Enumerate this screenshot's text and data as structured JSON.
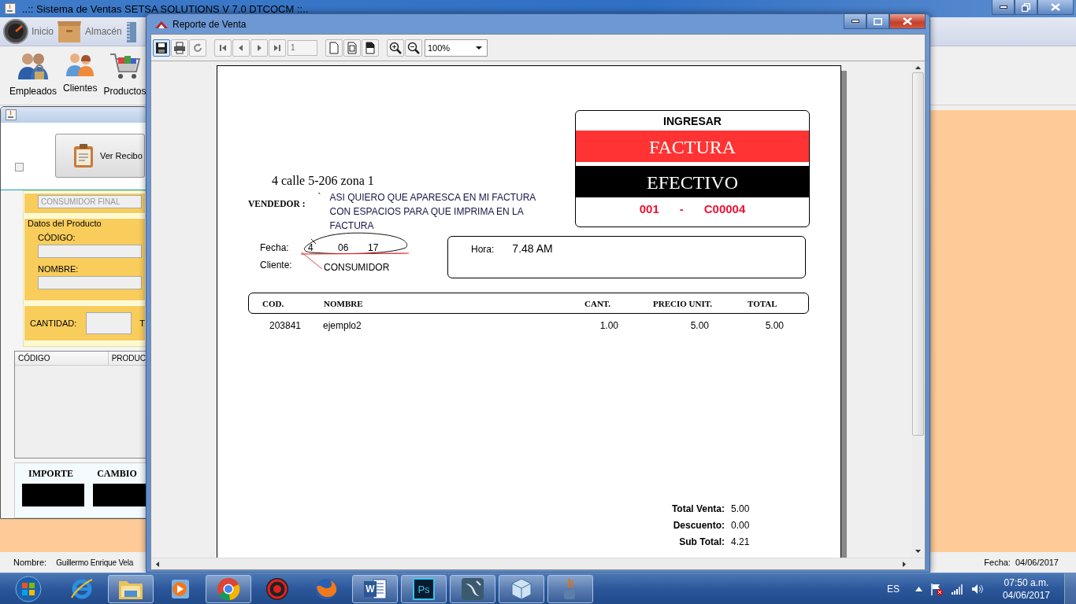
{
  "main_window": {
    "title": "..:: Sistema de Ventas SETSA SOLUTIONS V 7.0 DTCQCM ::..",
    "menu": [
      {
        "kind": "gauge",
        "label": "Inicio"
      },
      {
        "kind": "box",
        "label": "Almacén"
      },
      {
        "kind": "notebook"
      }
    ],
    "toolbar": [
      {
        "kind": "employees",
        "label": "Empleados"
      },
      {
        "kind": "clients",
        "label": "Clientes"
      },
      {
        "kind": "cart",
        "label": "Productos"
      }
    ],
    "status_bar": {
      "name_label": "Nombre:",
      "name_value": "Guillermo Enrique Vela",
      "date_label": "Fecha:",
      "date_value": "04/06/2017"
    }
  },
  "sales_window": {
    "checkbox": {
      "checked": false
    },
    "receipt_button": "Ver Recibo",
    "client_field": "CONSUMIDOR FINAL",
    "product_group": {
      "title": "Datos del Producto",
      "fields": [
        "CÓDIGO:",
        "NOMBRE:"
      ]
    },
    "quantity_label": "CANTIDAD:",
    "column_3": "T",
    "table_columns": [
      "CÓDIGO",
      "PRODUC"
    ],
    "payment_labels": [
      "IMPORTE",
      "CAMBIO"
    ]
  },
  "report_window": {
    "title": "Reporte de Venta",
    "page_number": "1",
    "zoom": "100%",
    "report": {
      "invoice_box": {
        "heading": "INGRESAR",
        "doc_type": "FACTURA",
        "payment": "EFECTIVO",
        "series": "001",
        "separator": "-",
        "number": "C00004"
      },
      "address": "4 calle 5-206 zona 1",
      "seller_label": "VENDEDOR :",
      "seller_mark": "`",
      "note": "ASI QUIERO QUE APARESCA EN MI FACTURA CON ESPACIOS PARA QUE IMPRIMA EN LA FACTURA",
      "date_label": "Fecha:",
      "date_parts": [
        "4",
        "06",
        "17"
      ],
      "client_label": "Cliente:",
      "client": "CONSUMIDOR",
      "time_label": "Hora:",
      "time": "7.48 AM",
      "columns": [
        "COD.",
        "NOMBRE",
        "CANT.",
        "PRECIO UNIT.",
        "TOTAL"
      ],
      "rows": [
        [
          "203841",
          "ejemplo2",
          "1.00",
          "5.00",
          "5.00"
        ]
      ],
      "totals": [
        {
          "label": "Total Venta:",
          "value": "5.00"
        },
        {
          "label": "Descuento:",
          "value": "0.00"
        },
        {
          "label": "Sub Total:",
          "value": "4.21"
        }
      ]
    }
  },
  "taskbar": {
    "apps": [
      {
        "kind": "ie",
        "running": false
      },
      {
        "kind": "explorer",
        "running": true
      },
      {
        "kind": "media",
        "running": false
      },
      {
        "kind": "chrome",
        "running": true
      },
      {
        "kind": "shield",
        "running": false
      },
      {
        "kind": "firefox",
        "running": false
      },
      {
        "kind": "word",
        "glyph": "W",
        "running": true
      },
      {
        "kind": "photoshop",
        "glyph": "Ps",
        "running": true
      },
      {
        "kind": "mysql",
        "running": true
      },
      {
        "kind": "cube",
        "running": true
      },
      {
        "kind": "java",
        "running": true
      }
    ],
    "language": "ES",
    "time": "07:50 a.m.",
    "date": "04/06/2017"
  }
}
